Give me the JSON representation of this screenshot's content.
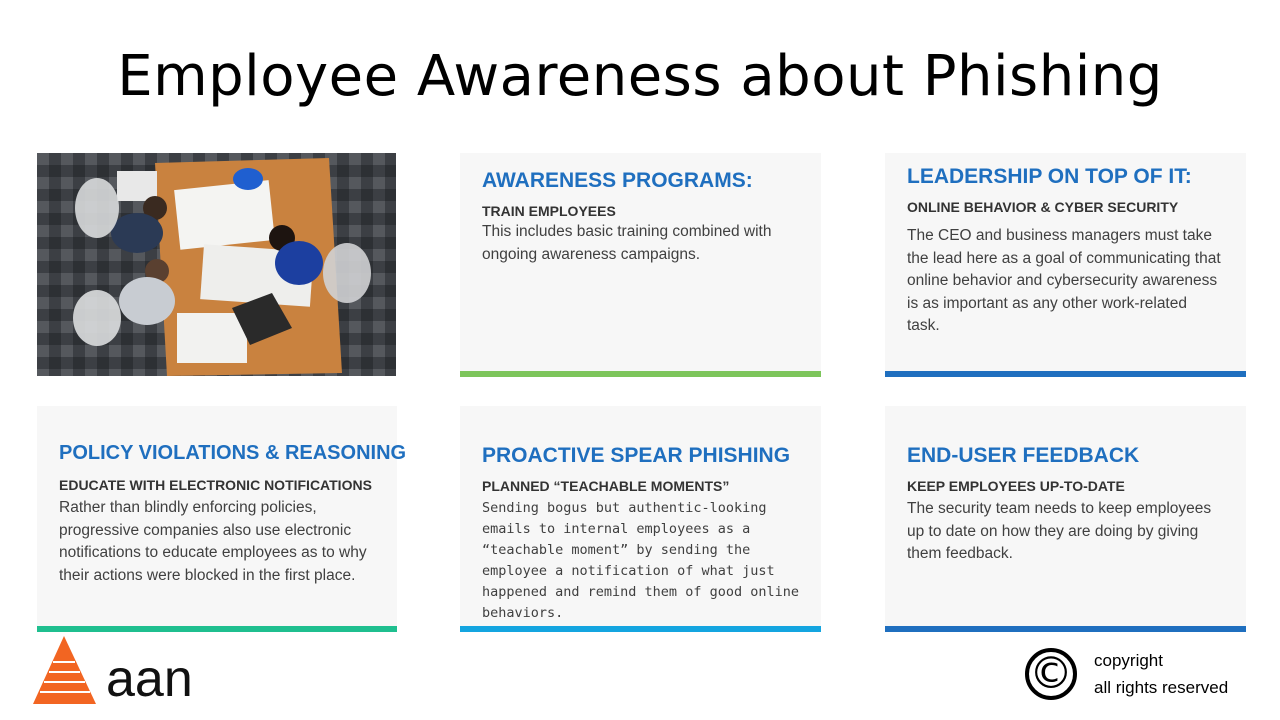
{
  "title": "Employee Awareness about Phishing",
  "colors": {
    "heading": "#1f6fbf",
    "green_bar": "#7dc55b",
    "blue_bar": "#1f6fbf",
    "teal_bar": "#1fbf8f",
    "cyan_bar": "#14a5e0"
  },
  "cards": [
    {
      "heading": "AWARENESS PROGRAMS:",
      "sub": "TRAIN EMPLOYEES",
      "body": "This includes basic training combined with ongoing awareness campaigns."
    },
    {
      "heading": "LEADERSHIP ON TOP OF IT:",
      "sub": "ONLINE BEHAVIOR & CYBER SECURITY",
      "body": "The CEO and business managers must take the lead here as a goal of communicating that online behavior and cybersecurity awareness is as important as any other work-related task."
    },
    {
      "heading": "POLICY VIOLATIONS & REASONING",
      "sub": "EDUCATE WITH ELECTRONIC NOTIFICATIONS",
      "body": "Rather than blindly enforcing policies, progressive companies also use electronic notifications to educate employees as to why their actions were blocked in the first place."
    },
    {
      "heading": "PROACTIVE SPEAR PHISHING",
      "sub": "PLANNED “TEACHABLE MOMENTS”",
      "body": "Sending bogus but authentic-looking emails to internal employees as a “teachable moment” by sending the employee a notification of what just happened and remind them of good online behaviors."
    },
    {
      "heading": "END-USER FEEDBACK",
      "sub": "KEEP EMPLOYEES UP-TO-DATE",
      "body": "The security team needs to keep employees up to date on how they are doing by giving them feedback."
    }
  ],
  "logo_text": "aan",
  "copyright": {
    "symbol": "©",
    "line1": "copyright",
    "line2": "all rights reserved"
  },
  "photo_icon": "office-meeting-photo"
}
